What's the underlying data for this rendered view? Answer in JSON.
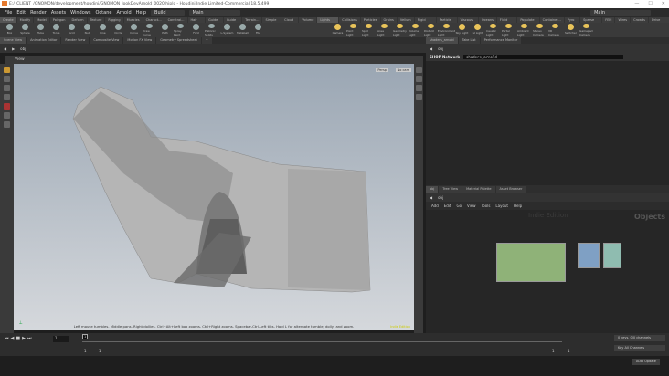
{
  "title": "E:/_CLIENT_/GNOMON/development/houdini/GNOMON_lookDevArnold_0020.hiplc - Houdini Indie Limited-Commercial 18.5.499",
  "menu": [
    "File",
    "Edit",
    "Render",
    "Assets",
    "Windows",
    "Octane",
    "Arnold",
    "Help"
  ],
  "desktop": "Build",
  "desktop_right": "Main",
  "desktop_main": "Main",
  "shelf_tabs": [
    "Create",
    "Modify",
    "Model",
    "Polygon",
    "Deform",
    "Texture",
    "Rigging",
    "Muscles",
    "Charact...",
    "Constrai...",
    "Hair Utils",
    "Guide P...",
    "Guide B...",
    "Terrain...",
    "Simple FX",
    "Cloud FX",
    "Volume",
    "Lights and...",
    "Collisions",
    "Particles",
    "Grains",
    "Vellum",
    "Rigid Bodies",
    "Particle Fl...",
    "Viscous Fl...",
    "Oceans",
    "Fluid Con...",
    "Populate C...",
    "Container...",
    "Pyro FX",
    "Sparse Pyr...",
    "FEM",
    "Wires",
    "Crowds",
    "Drive Sim..."
  ],
  "shelf_tools": [
    "Box",
    "Sphere",
    "Tube",
    "Torus",
    "Grid",
    "Null",
    "Line",
    "Circle",
    "Curve",
    "Draw Curve",
    "Path",
    "Spray Paint",
    "Font",
    "Platonic Solids",
    "L-System",
    "Metaball",
    "File",
    "Camera",
    "Point Light",
    "Spot Light",
    "Area Light",
    "Geometry Light",
    "Volume Light",
    "Distant Light",
    "Environment Light",
    "Sky Light",
    "GI Light",
    "Caustic Light",
    "Portal Light",
    "Ambient Light",
    "Stereo Camera",
    "VR Camera",
    "Switcher",
    "Gamepad Camera"
  ],
  "left_tabs": [
    "Scene View",
    "Animation Editor",
    "Render View",
    "Composite View",
    "Motion FX View",
    "Geometry Spreadsheet"
  ],
  "path": "obj",
  "view_label": "View",
  "persp": "Persp",
  "no_cam": "No cam",
  "hint": "Left mouse tumbles. Middle pans. Right dollies. Ctrl+Alt+Left box zooms. Ctrl+Right zooms. Spacebar-Ctrl-Left tilts. Hold L for alternate tumble, dolly, and zoom.",
  "indie_edition": "Indie Edition",
  "right_top_tabs": [
    "shaders_arnold",
    "Take List",
    "Performance Monitor"
  ],
  "shop_label": "SHOP Network",
  "shop_value": "shaders_arnold",
  "right_bottom_tabs": [
    "obj",
    "Tree View",
    "Material Palette",
    "Asset Browser"
  ],
  "net_menu": [
    "Add",
    "Edit",
    "Go",
    "View",
    "Tools",
    "Layout",
    "Help"
  ],
  "net_watermark": "Indie Edition",
  "net_context": "Objects",
  "timeline": {
    "frame": "1",
    "marker": "1",
    "start": "1",
    "end": "1",
    "range_end": "1",
    "range_end2": "1"
  },
  "keys": "0 keys, 0/0 channels",
  "key_all": "Key All Channels",
  "auto_update": "Auto Update"
}
